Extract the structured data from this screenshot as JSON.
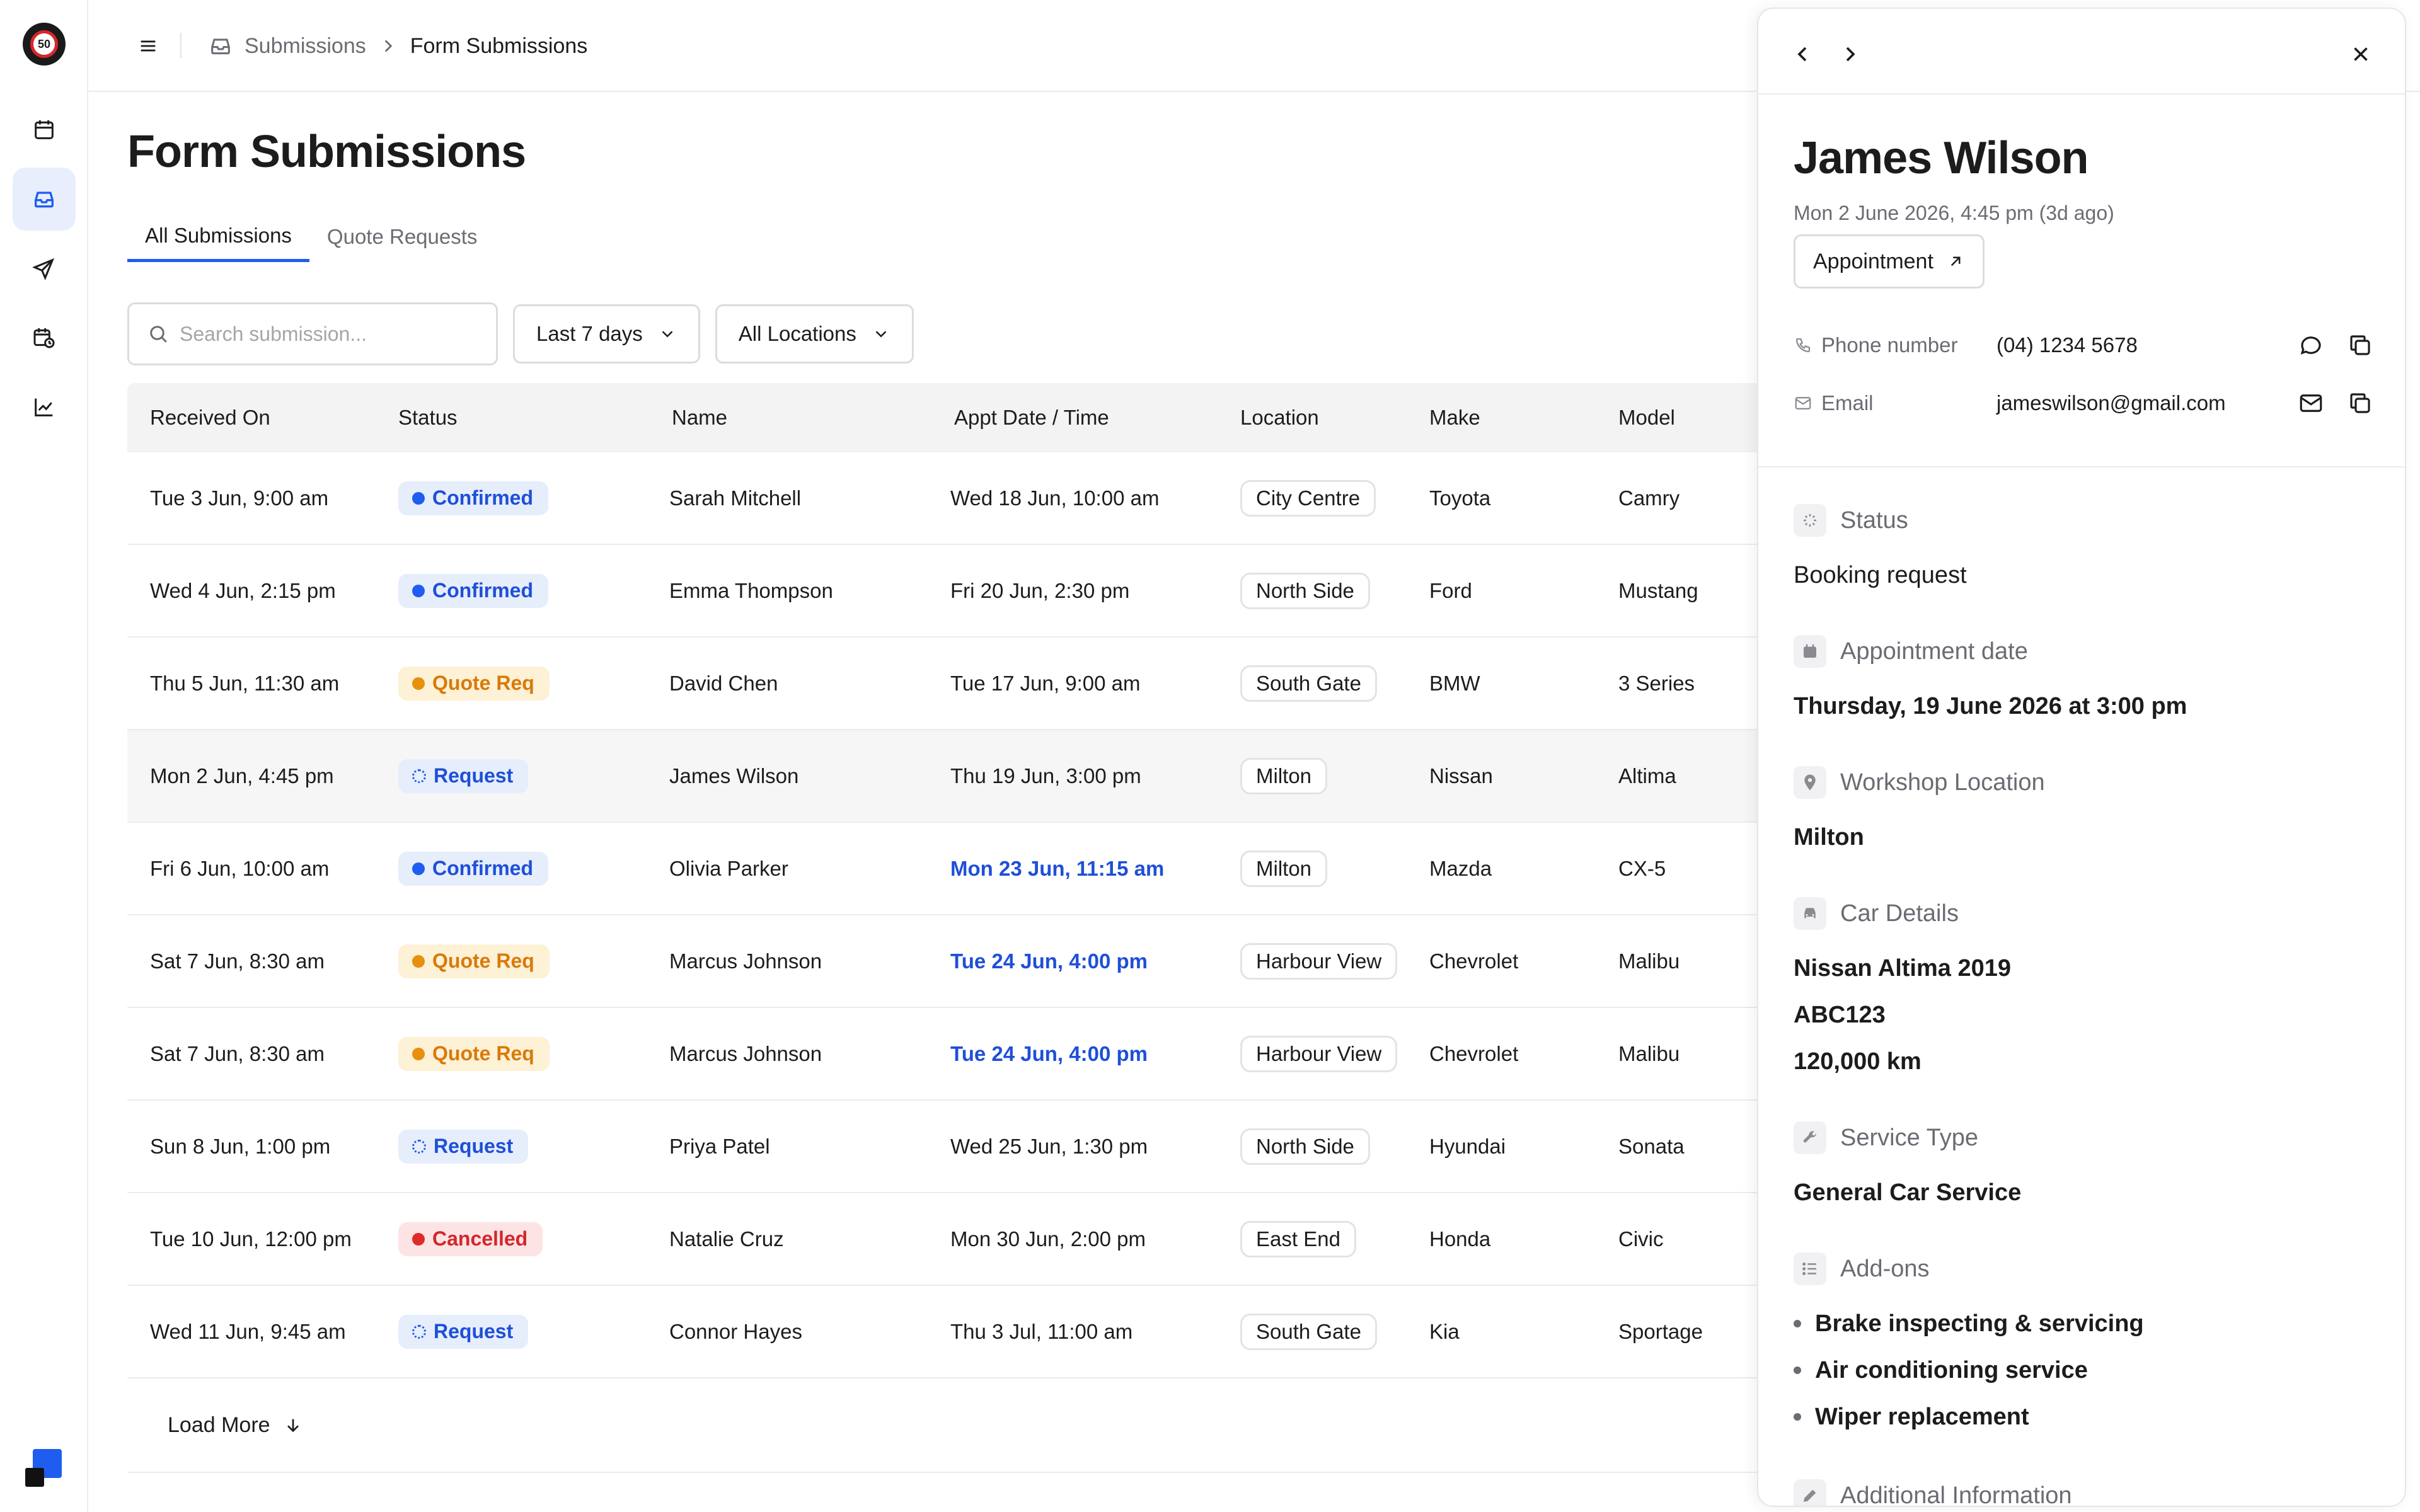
{
  "breadcrumb": {
    "parent": "Submissions",
    "current": "Form Submissions"
  },
  "page": {
    "title": "Form Submissions",
    "tabs": [
      {
        "label": "All Submissions",
        "active": true
      },
      {
        "label": "Quote Requests",
        "active": false
      }
    ]
  },
  "filters": {
    "search_placeholder": "Search submission...",
    "date_range": "Last 7 days",
    "location": "All Locations"
  },
  "table": {
    "columns": [
      "Received On",
      "Status",
      "Name",
      "Appt Date / Time",
      "Location",
      "Make",
      "Model"
    ],
    "rows": [
      {
        "received": "Tue 3 Jun, 9:00 am",
        "status": "Confirmed",
        "status_kind": "blue",
        "name": "Sarah Mitchell",
        "appt": "Wed 18 Jun, 10:00 am",
        "appt_highlight": false,
        "location": "City Centre",
        "make": "Toyota",
        "model": "Camry"
      },
      {
        "received": "Wed 4 Jun, 2:15 pm",
        "status": "Confirmed",
        "status_kind": "blue",
        "name": "Emma Thompson",
        "appt": "Fri 20 Jun, 2:30 pm",
        "appt_highlight": false,
        "location": "North Side",
        "make": "Ford",
        "model": "Mustang"
      },
      {
        "received": "Thu 5 Jun, 11:30 am",
        "status": "Quote Req",
        "status_kind": "amber",
        "name": "David Chen",
        "appt": "Tue 17 Jun, 9:00 am",
        "appt_highlight": false,
        "location": "South Gate",
        "make": "BMW",
        "model": "3 Series"
      },
      {
        "received": "Mon 2 Jun, 4:45 pm",
        "status": "Request",
        "status_kind": "req",
        "name": "James Wilson",
        "appt": "Thu 19 Jun, 3:00 pm",
        "appt_highlight": false,
        "location": "Milton",
        "make": "Nissan",
        "model": "Altima",
        "selected": true
      },
      {
        "received": "Fri 6 Jun, 10:00 am",
        "status": "Confirmed",
        "status_kind": "blue",
        "name": "Olivia Parker",
        "appt": "Mon 23 Jun, 11:15 am",
        "appt_highlight": true,
        "location": "Milton",
        "make": "Mazda",
        "model": "CX-5"
      },
      {
        "received": "Sat 7 Jun, 8:30 am",
        "status": "Quote Req",
        "status_kind": "amber",
        "name": "Marcus Johnson",
        "appt": "Tue 24 Jun, 4:00 pm",
        "appt_highlight": true,
        "location": "Harbour View",
        "make": "Chevrolet",
        "model": "Malibu"
      },
      {
        "received": "Sat 7 Jun, 8:30 am",
        "status": "Quote Req",
        "status_kind": "amber",
        "name": "Marcus Johnson",
        "appt": "Tue 24 Jun, 4:00 pm",
        "appt_highlight": true,
        "location": "Harbour View",
        "make": "Chevrolet",
        "model": "Malibu"
      },
      {
        "received": "Sun 8 Jun, 1:00 pm",
        "status": "Request",
        "status_kind": "req",
        "name": "Priya Patel",
        "appt": "Wed 25 Jun, 1:30 pm",
        "appt_highlight": false,
        "location": "North Side",
        "make": "Hyundai",
        "model": "Sonata"
      },
      {
        "received": "Tue 10 Jun, 12:00 pm",
        "status": "Cancelled",
        "status_kind": "red",
        "name": "Natalie Cruz",
        "appt": "Mon 30 Jun, 2:00 pm",
        "appt_highlight": false,
        "location": "East End",
        "make": "Honda",
        "model": "Civic"
      },
      {
        "received": "Wed 11 Jun, 9:45 am",
        "status": "Request",
        "status_kind": "req",
        "name": "Connor Hayes",
        "appt": "Thu 3 Jul, 11:00 am",
        "appt_highlight": false,
        "location": "South Gate",
        "make": "Kia",
        "model": "Sportage"
      }
    ],
    "load_more": "Load More"
  },
  "detail": {
    "name": "James Wilson",
    "submitted": "Mon 2 June 2026, 4:45 pm (3d ago)",
    "type_chip": "Appointment",
    "phone_label": "Phone number",
    "phone": "(04) 1234 5678",
    "email_label": "Email",
    "email": "jameswilson@gmail.com",
    "sections": {
      "status": {
        "label": "Status",
        "value": "Booking request"
      },
      "appointment_date": {
        "label": "Appointment date",
        "value": "Thursday, 19 June 2026 at 3:00 pm"
      },
      "workshop_location": {
        "label": "Workshop Location",
        "value": "Milton"
      },
      "car_details": {
        "label": "Car Details",
        "vehicle": "Nissan Altima 2019",
        "plate": "ABC123",
        "odometer": "120,000 km"
      },
      "service_type": {
        "label": "Service Type",
        "value": "General Car Service"
      },
      "addons": {
        "label": "Add-ons",
        "items": [
          "Brake inspecting & servicing",
          "Air conditioning service",
          "Wiper replacement"
        ]
      },
      "additional_info": {
        "label": "Additional Information"
      }
    }
  },
  "colors": {
    "accent": "#1f5cf0",
    "status_blue": "#1f4fd8",
    "status_amber": "#d97a0a",
    "status_red": "#d4262b"
  },
  "icons": {
    "rail": [
      "calendar-icon",
      "inbox-icon",
      "send-icon",
      "calendar-clock-icon",
      "chart-line-icon"
    ]
  }
}
